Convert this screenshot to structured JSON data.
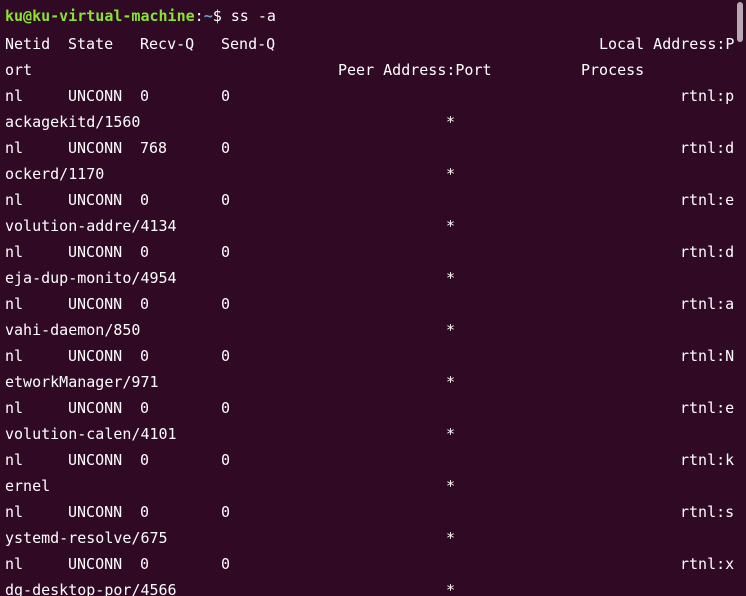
{
  "prompt": {
    "user_host": "ku@ku-virtual-machine",
    "separator": ":",
    "path": "~",
    "symbol": "$",
    "command": " ss -a"
  },
  "header": {
    "netid": "Netid",
    "state": "State",
    "recv_q": "Recv-Q",
    "send_q": "Send-Q",
    "local_address_part1": "Local Address:P",
    "local_address_part2": "ort",
    "peer_address": "Peer Address:Port",
    "process": "Process"
  },
  "rows": [
    {
      "netid": "nl",
      "state": "UNCONN",
      "recv_q": "0",
      "send_q": "0",
      "local_a": "rtnl:p",
      "local_b": "ackagekitd/1560",
      "peer": "*"
    },
    {
      "netid": "nl",
      "state": "UNCONN",
      "recv_q": "768",
      "send_q": "0",
      "local_a": "rtnl:d",
      "local_b": "ockerd/1170",
      "peer": "*"
    },
    {
      "netid": "nl",
      "state": "UNCONN",
      "recv_q": "0",
      "send_q": "0",
      "local_a": "rtnl:e",
      "local_b": "volution-addre/4134",
      "peer": "*"
    },
    {
      "netid": "nl",
      "state": "UNCONN",
      "recv_q": "0",
      "send_q": "0",
      "local_a": "rtnl:d",
      "local_b": "eja-dup-monito/4954",
      "peer": "*"
    },
    {
      "netid": "nl",
      "state": "UNCONN",
      "recv_q": "0",
      "send_q": "0",
      "local_a": "rtnl:a",
      "local_b": "vahi-daemon/850",
      "peer": "*"
    },
    {
      "netid": "nl",
      "state": "UNCONN",
      "recv_q": "0",
      "send_q": "0",
      "local_a": "rtnl:N",
      "local_b": "etworkManager/971",
      "peer": "*"
    },
    {
      "netid": "nl",
      "state": "UNCONN",
      "recv_q": "0",
      "send_q": "0",
      "local_a": "rtnl:e",
      "local_b": "volution-calen/4101",
      "peer": "*"
    },
    {
      "netid": "nl",
      "state": "UNCONN",
      "recv_q": "0",
      "send_q": "0",
      "local_a": "rtnl:k",
      "local_b": "ernel",
      "peer": "*"
    },
    {
      "netid": "nl",
      "state": "UNCONN",
      "recv_q": "0",
      "send_q": "0",
      "local_a": "rtnl:s",
      "local_b": "ystemd-resolve/675",
      "peer": "*"
    },
    {
      "netid": "nl",
      "state": "UNCONN",
      "recv_q": "0",
      "send_q": "0",
      "local_a": "rtnl:x",
      "local_b": "dg-desktop-por/4566",
      "peer": "*"
    }
  ],
  "colors": {
    "background": "#300a24",
    "text": "#ffffff",
    "prompt_user": "#8ae234",
    "prompt_path": "#729fcf"
  }
}
